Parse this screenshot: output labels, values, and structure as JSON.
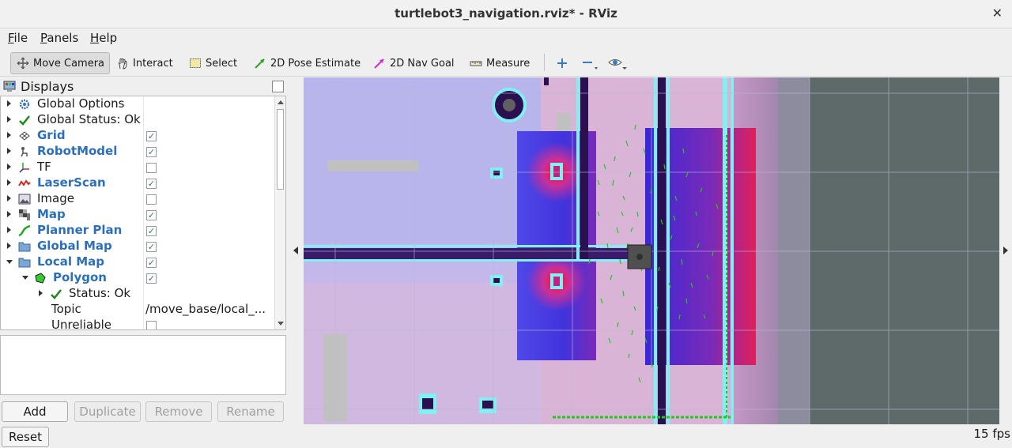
{
  "window": {
    "title": "turtlebot3_navigation.rviz* - RViz",
    "close_glyph": "✕"
  },
  "menu": [
    "File",
    "Panels",
    "Help"
  ],
  "toolbar": {
    "tools": [
      {
        "label": "Move Camera",
        "icon": "move-camera-icon",
        "active": true
      },
      {
        "label": "Interact",
        "icon": "hand-icon"
      },
      {
        "label": "Select",
        "icon": "select-box-icon"
      },
      {
        "label": "2D Pose Estimate",
        "icon": "green-arrow-icon"
      },
      {
        "label": "2D Nav Goal",
        "icon": "magenta-arrow-icon"
      },
      {
        "label": "Measure",
        "icon": "ruler-icon"
      }
    ],
    "extra_icons": [
      "plus-icon",
      "minus-icon",
      "eye-icon"
    ]
  },
  "displays": {
    "title": "Displays",
    "rows": [
      {
        "name": "Global Options",
        "icon": "gear-icon",
        "highlight": false,
        "checkbox": null
      },
      {
        "name": "Global Status: Ok",
        "icon": "check-icon",
        "highlight": false,
        "checkbox": null
      },
      {
        "name": "Grid",
        "icon": "grid-icon",
        "highlight": true,
        "checkbox": true
      },
      {
        "name": "RobotModel",
        "icon": "robot-icon",
        "highlight": true,
        "checkbox": true
      },
      {
        "name": "TF",
        "icon": "tf-icon",
        "highlight": false,
        "checkbox": false
      },
      {
        "name": "LaserScan",
        "icon": "laser-icon",
        "highlight": true,
        "checkbox": true
      },
      {
        "name": "Image",
        "icon": "image-icon",
        "highlight": false,
        "checkbox": false
      },
      {
        "name": "Map",
        "icon": "map-icon",
        "highlight": true,
        "checkbox": true
      },
      {
        "name": "Planner Plan",
        "icon": "path-icon",
        "highlight": true,
        "checkbox": true
      },
      {
        "name": "Global Map",
        "icon": "folder-icon",
        "highlight": true,
        "checkbox": true
      },
      {
        "name": "Local Map",
        "icon": "folder-icon",
        "highlight": true,
        "checkbox": true
      },
      {
        "name": "Polygon",
        "icon": "polygon-icon",
        "highlight": true,
        "checkbox": true
      },
      {
        "name": "Status: Ok",
        "icon": "check-icon",
        "highlight": false,
        "checkbox": null
      },
      {
        "name": "Topic",
        "value": "/move_base/local_...",
        "highlight": false,
        "checkbox": null
      },
      {
        "name": "Unreliable",
        "highlight": false,
        "checkbox": false
      }
    ]
  },
  "buttons": {
    "add": "Add",
    "duplicate": "Duplicate",
    "remove": "Remove",
    "rename": "Rename"
  },
  "status": {
    "reset": "Reset",
    "fps": "15 fps"
  }
}
